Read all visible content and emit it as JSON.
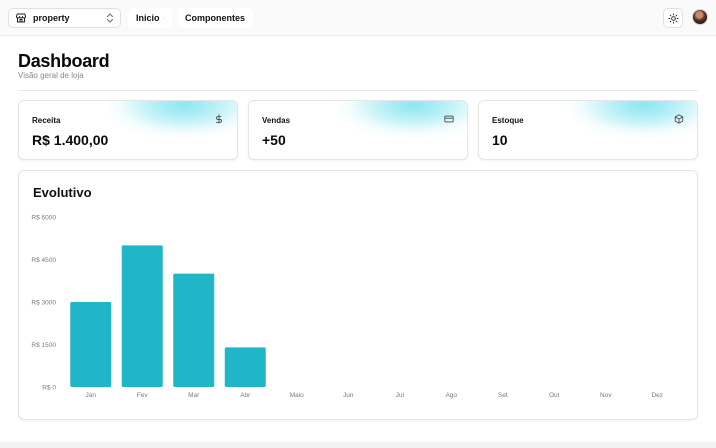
{
  "topbar": {
    "store": {
      "label": "property",
      "icon": "store-icon"
    },
    "nav": [
      {
        "label": "Inicio",
        "icon": "chevron-down-icon"
      },
      {
        "label": "Componentes",
        "icon": "chevron-down-icon"
      }
    ],
    "theme_icon": "sun-icon",
    "avatar_icon": "avatar"
  },
  "header": {
    "title": "Dashboard",
    "subtitle": "Visão geral de loja"
  },
  "cards": [
    {
      "label": "Receita",
      "value": "R$ 1.400,00",
      "icon": "dollar-icon"
    },
    {
      "label": "Vendas",
      "value": "+50",
      "icon": "credit-card-icon"
    },
    {
      "label": "Estoque",
      "value": "10",
      "icon": "box-icon"
    }
  ],
  "colors": {
    "accent": "#21b6c7",
    "glow": "#4cd8ea"
  },
  "chart_data": {
    "type": "bar",
    "title": "Evolutivo",
    "categories": [
      "Jan",
      "Fev",
      "Mar",
      "Abr",
      "Maio",
      "Jun",
      "Jul",
      "Ago",
      "Set",
      "Out",
      "Nov",
      "Dez"
    ],
    "values": [
      3000,
      5000,
      4000,
      1400,
      0,
      0,
      0,
      0,
      0,
      0,
      0,
      0
    ],
    "ylim": [
      0,
      6000
    ],
    "yticks": [
      0,
      1500,
      3000,
      4500,
      6000
    ],
    "ytick_labels": [
      "R$ 0",
      "R$ 1500",
      "R$ 3000",
      "R$ 4500",
      "R$ 6000"
    ],
    "grid": false,
    "color": "#21b6c7"
  }
}
